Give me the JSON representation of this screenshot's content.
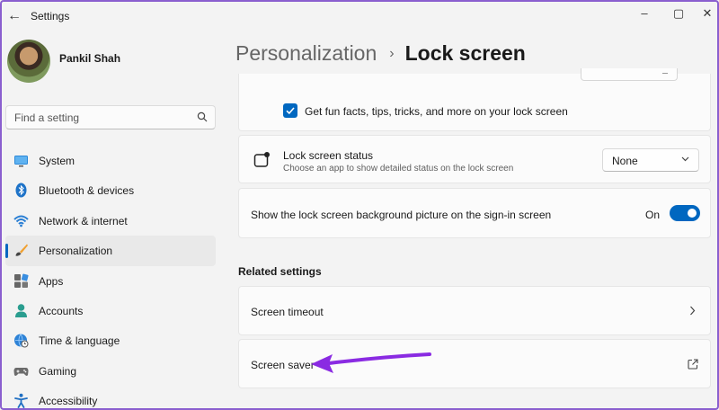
{
  "window": {
    "title": "Settings",
    "minimize_glyph": "–",
    "maximize_glyph": "▢",
    "close_glyph": "✕",
    "back_glyph": "←"
  },
  "profile": {
    "name": "Pankil Shah"
  },
  "search": {
    "placeholder": "Find a setting"
  },
  "nav": {
    "items": [
      {
        "label": "System",
        "icon": "monitor-icon"
      },
      {
        "label": "Bluetooth & devices",
        "icon": "bluetooth-icon"
      },
      {
        "label": "Network & internet",
        "icon": "wifi-icon"
      },
      {
        "label": "Personalization",
        "icon": "brush-icon",
        "active": true
      },
      {
        "label": "Apps",
        "icon": "apps-icon"
      },
      {
        "label": "Accounts",
        "icon": "person-icon"
      },
      {
        "label": "Time & language",
        "icon": "globe-clock-icon"
      },
      {
        "label": "Gaming",
        "icon": "gamepad-icon"
      },
      {
        "label": "Accessibility",
        "icon": "accessibility-icon"
      }
    ]
  },
  "breadcrumb": {
    "parent": "Personalization",
    "separator": "›",
    "current": "Lock screen"
  },
  "settings": {
    "fun_facts": {
      "label": "Get fun facts, tips, tricks, and more on your lock screen",
      "checked": true
    },
    "lock_status": {
      "title": "Lock screen status",
      "subtitle": "Choose an app to show detailed status on the lock screen",
      "value": "None"
    },
    "signin_background": {
      "label": "Show the lock screen background picture on the sign-in screen",
      "state_label": "On",
      "on": true
    }
  },
  "related": {
    "title": "Related settings",
    "items": [
      {
        "label": "Screen timeout",
        "icon": "chevron-right-icon"
      },
      {
        "label": "Screen saver",
        "icon": "external-link-icon"
      }
    ]
  },
  "colors": {
    "accent": "#0067c0",
    "annotation_arrow": "#8a2be2",
    "frame_border": "#8a5fcf"
  }
}
